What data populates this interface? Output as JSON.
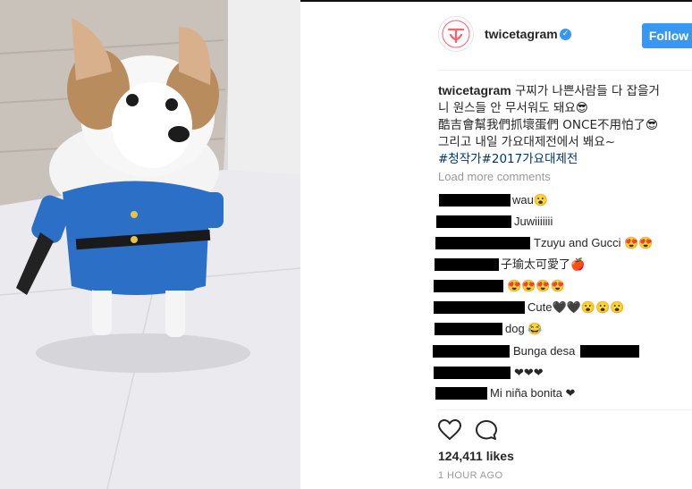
{
  "post": {
    "username": "twicetagram",
    "follow_label": "Follow",
    "caption_user": "twicetagram",
    "caption_lines": [
      "구찌가 나쁜사람들 다 잡을거",
      "니 원스들 안 무서워도 돼요😎",
      "酷吉會幫我們抓壞蛋們 ONCE不用怕了😎",
      "그리고 내일 가요대제전에서 봬요~"
    ],
    "hashtags": "#청작가#2017가요대제전",
    "load_more": "Load more comments",
    "likes": "124,411 likes",
    "time": "1 HOUR AGO"
  },
  "comments": [
    {
      "text": "wau😮"
    },
    {
      "text": "Juwiiiiiii"
    },
    {
      "text": "Tzuyu and Gucci 😍😍"
    },
    {
      "text": "子瑜太可愛了🍎"
    },
    {
      "text": "😍😍😍😍"
    },
    {
      "text": "Cute🖤🖤😮😮😮"
    },
    {
      "text": "dog 😂"
    },
    {
      "text": "Bunga desa"
    },
    {
      "text": "❤❤❤"
    },
    {
      "text": "Mi niña bonita ❤"
    }
  ],
  "colors": {
    "accent": "#3897f0",
    "hashtag": "#003569",
    "muted": "#999999",
    "logo": "#ff5f6d"
  },
  "icons": {
    "like": "heart-icon",
    "comment": "comment-bubble-icon",
    "verified": "verified-badge-icon"
  }
}
